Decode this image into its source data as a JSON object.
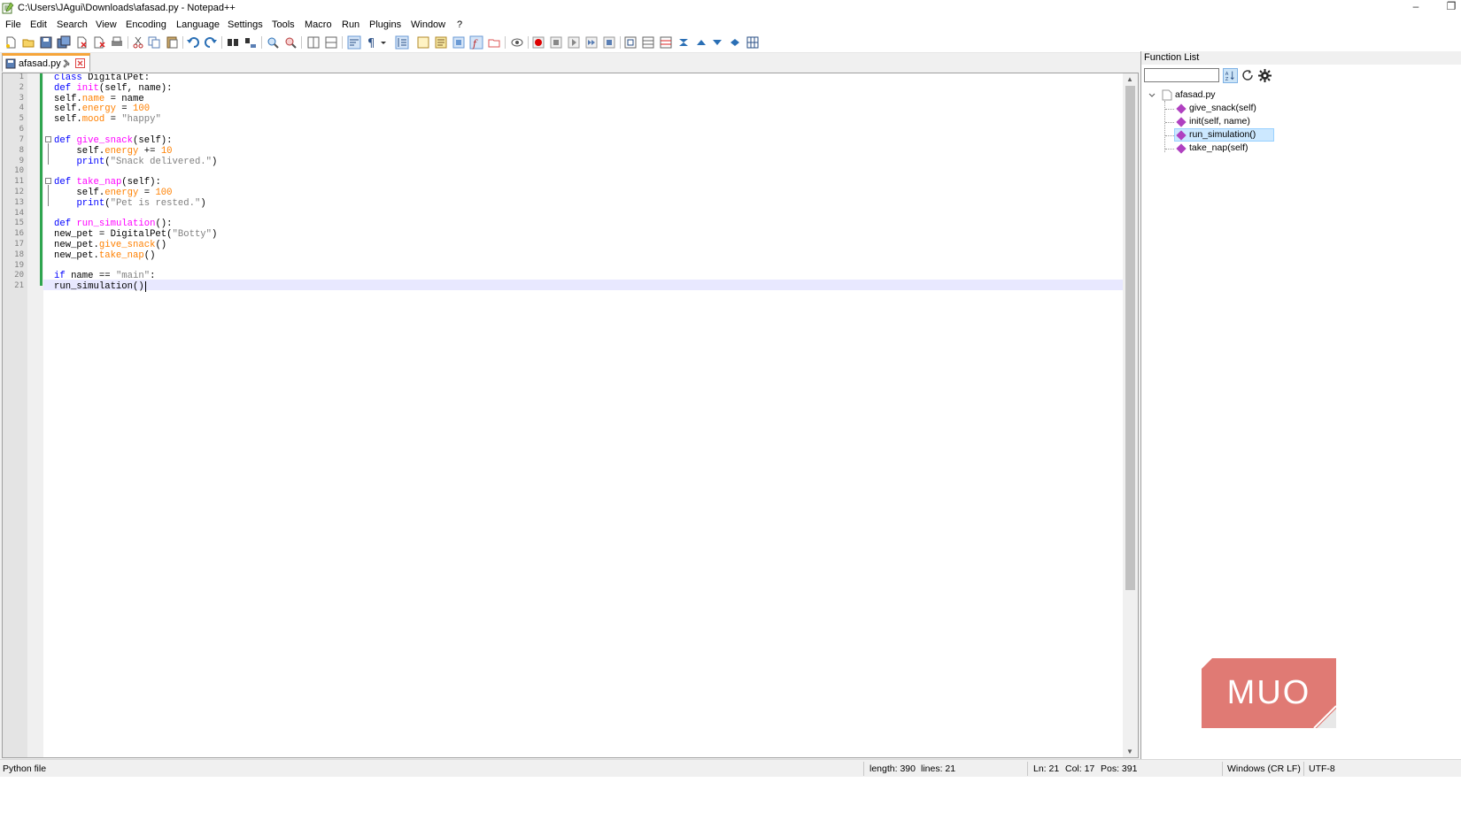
{
  "window": {
    "title": "C:\\Users\\JAgui\\Downloads\\afasad.py - Notepad++",
    "minimize_glyph": "–",
    "restore_glyph": "❐"
  },
  "menu": [
    "File",
    "Edit",
    "Search",
    "View",
    "Encoding",
    "Language",
    "Settings",
    "Tools",
    "Macro",
    "Run",
    "Plugins",
    "Window",
    "?"
  ],
  "tab": {
    "label": "afasad.py"
  },
  "editor": {
    "line_numbers": [
      "1",
      "2",
      "3",
      "4",
      "5",
      "6",
      "7",
      "8",
      "9",
      "10",
      "11",
      "12",
      "13",
      "14",
      "15",
      "16",
      "17",
      "18",
      "19",
      "20",
      "21"
    ],
    "lines": [
      "class DigitalPet:",
      "def init(self, name):",
      "self.name = name",
      "self.energy = 100",
      "self.mood = \"happy\"",
      "",
      "def give_snack(self):",
      "    self.energy += 10",
      "    print(\"Snack delivered.\")",
      "",
      "def take_nap(self):",
      "    self.energy = 100",
      "    print(\"Pet is rested.\")",
      "",
      "def run_simulation():",
      "new_pet = DigitalPet(\"Botty\")",
      "new_pet.give_snack()",
      "new_pet.take_nap()",
      "",
      "if name == \"main\":",
      "run_simulation()"
    ]
  },
  "function_list": {
    "title": "Function List",
    "search_value": "",
    "file": "afasad.py",
    "items": [
      "give_snack(self)",
      "init(self, name)",
      "run_simulation()",
      "take_nap(self)"
    ],
    "selected": "run_simulation()"
  },
  "watermark": "MUO",
  "status": {
    "file_type": "Python file",
    "length": "length: 390",
    "lines": "lines: 21",
    "ln": "Ln: 21",
    "col": "Col: 17",
    "pos": "Pos: 391",
    "eol": "Windows (CR LF)",
    "encoding": "UTF-8"
  },
  "colors": {
    "keyword": "#0000ff",
    "string": "#808080",
    "number": "#ff8000",
    "function": "#ff00ff",
    "tab_accent": "#f6a53a",
    "watermark": "#e07a74"
  }
}
